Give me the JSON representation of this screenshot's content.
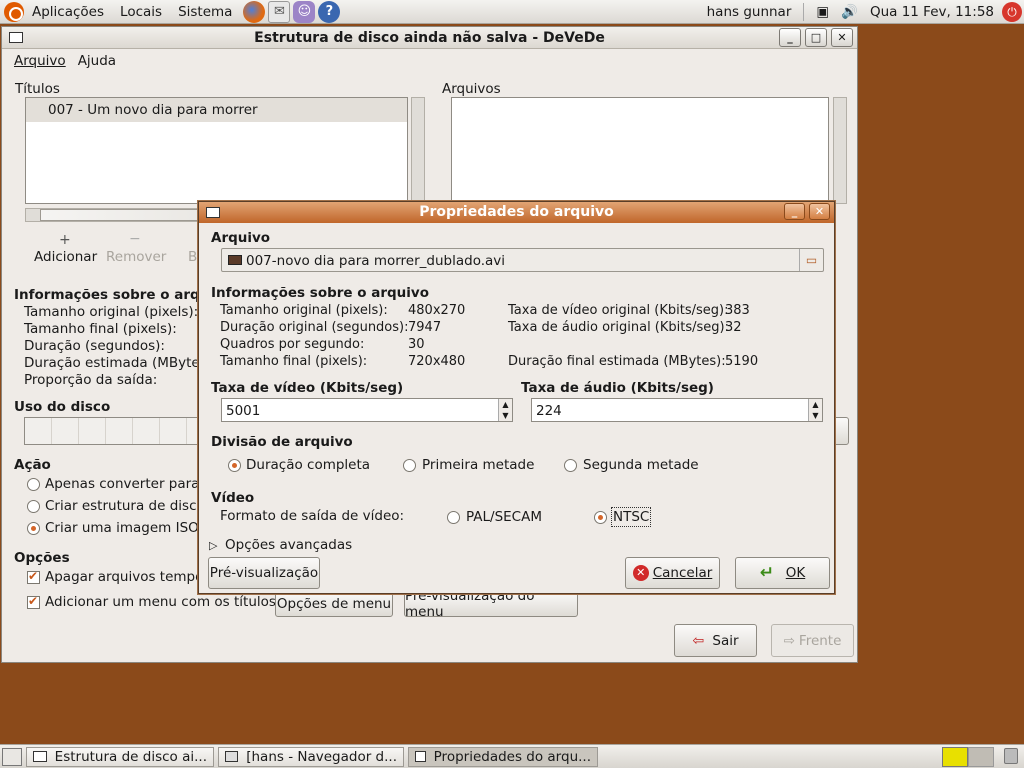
{
  "top_panel": {
    "menus": [
      "Aplicações",
      "Locais",
      "Sistema"
    ],
    "user": "hans gunnar",
    "clock": "Qua 11 Fev, 11:58"
  },
  "main_window": {
    "title": "Estrutura de disco ainda não salva - DeVeDe",
    "menu": [
      "Arquivo",
      "Ajuda"
    ],
    "titles_header": "Títulos",
    "titles_list": [
      "007 - Um novo dia para morrer"
    ],
    "files_header": "Arquivos",
    "btn_add": "Adicionar",
    "btn_remove": "Remover",
    "btn_b": "B",
    "info_header": "Informações sobre o arq",
    "info_rows": [
      "Tamanho original (pixels):",
      "Tamanho final (pixels):",
      "Duração (segundos):",
      "Duração estimada (MBytes",
      "Proporção da saída:"
    ],
    "disk_usage": "Uso do disco",
    "action_header": "Ação",
    "actions": [
      "Apenas converter para",
      "Criar estrutura de disco",
      "Criar uma imagem ISO"
    ],
    "options_header": "Opções",
    "option1": "Apagar arquivos tempor",
    "option2": "Adicionar um menu com os títulos",
    "btn_menu_options": "Opções de menu",
    "btn_menu_preview": "Pré-visualização do menu",
    "btn_quit": "Sair",
    "btn_next": "Frente"
  },
  "dialog": {
    "title": "Propriedades do arquivo",
    "file_header": "Arquivo",
    "file_name": "007-novo dia para morrer_dublado.avi",
    "info_header": "Informações sobre o arquivo",
    "info_left": [
      {
        "label": "Tamanho original (pixels):",
        "value": "480x270"
      },
      {
        "label": "Duração original (segundos):",
        "value": "7947"
      },
      {
        "label": "Quadros por segundo:",
        "value": "30"
      },
      {
        "label": "Tamanho final (pixels):",
        "value": "720x480"
      }
    ],
    "info_right": [
      {
        "label": "Taxa de vídeo original (Kbits/seg):",
        "value": "383"
      },
      {
        "label": "Taxa de áudio original (Kbits/seg):",
        "value": "32"
      },
      {
        "label": "Duração final estimada (MBytes):",
        "value": "5190"
      }
    ],
    "video_rate_label": "Taxa de vídeo (Kbits/seg)",
    "video_rate": "5001",
    "audio_rate_label": "Taxa de áudio (Kbits/seg)",
    "audio_rate": "224",
    "split_header": "Divisão de arquivo",
    "split_options": [
      "Duração completa",
      "Primeira metade",
      "Segunda metade"
    ],
    "video_header": "Vídeo",
    "video_format_label": "Formato de saída de vídeo:",
    "format_options": [
      "PAL/SECAM",
      "NTSC"
    ],
    "advanced": "Opções avançadas",
    "btn_preview": "Pré-visualização",
    "btn_cancel": "Cancelar",
    "btn_ok": "OK"
  },
  "taskbar": {
    "tasks": [
      "Estrutura de disco ai...",
      "[hans - Navegador d...",
      "Propriedades do arqu..."
    ]
  }
}
